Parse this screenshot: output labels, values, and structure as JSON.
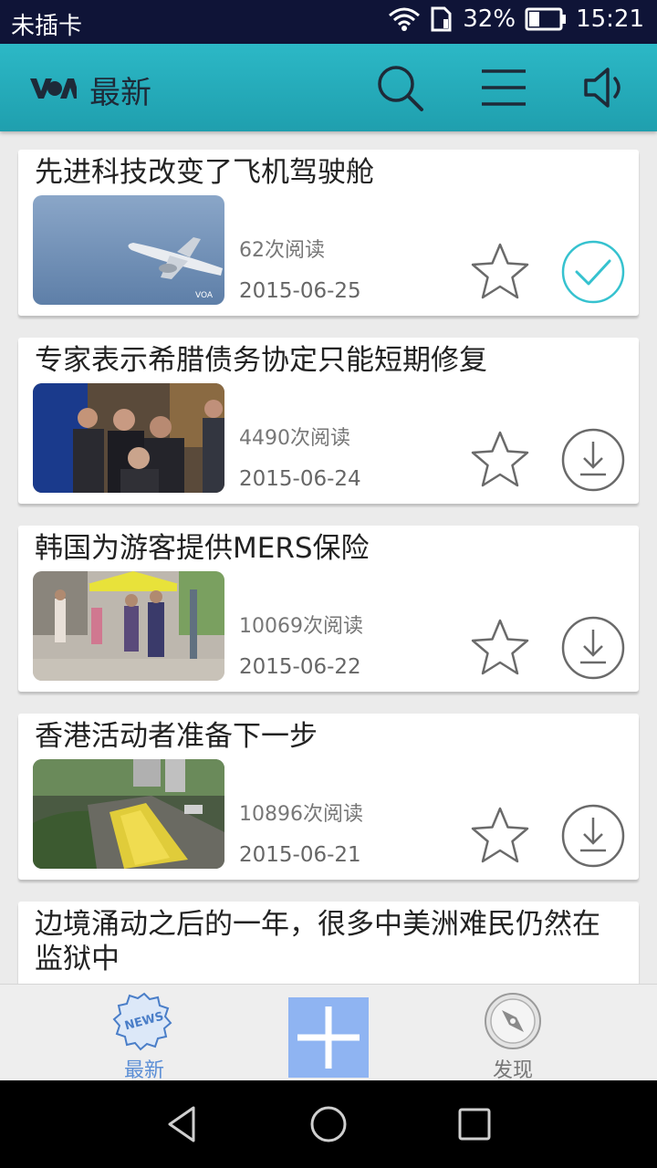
{
  "status_bar": {
    "carrier": "未插卡",
    "battery": "32%",
    "time": "15:21"
  },
  "app_bar": {
    "logo_text": "VOA",
    "title": "最新",
    "actions": [
      "search-icon",
      "menu-icon",
      "speaker-icon"
    ]
  },
  "articles": [
    {
      "title": "先进科技改变了飞机驾驶舱",
      "reads": "62次阅读",
      "date": "2015-06-25",
      "status": "downloaded"
    },
    {
      "title": "专家表示希腊债务协定只能短期修复",
      "reads": "4490次阅读",
      "date": "2015-06-24",
      "status": "download"
    },
    {
      "title": "韩国为游客提供MERS保险",
      "reads": "10069次阅读",
      "date": "2015-06-22",
      "status": "download"
    },
    {
      "title": "香港活动者准备下一步",
      "reads": "10896次阅读",
      "date": "2015-06-21",
      "status": "download"
    },
    {
      "title": "边境涌动之后的一年，很多中美洲难民仍然在监狱中"
    }
  ],
  "bottom_nav": {
    "news_badge": "NEWS",
    "news_label": "最新",
    "discover_label": "发现"
  },
  "colors": {
    "accent": "#2db3c0",
    "app_bar": "#24a9b7",
    "add_button": "#8fb4f2",
    "status_bar": "#0f1437"
  }
}
